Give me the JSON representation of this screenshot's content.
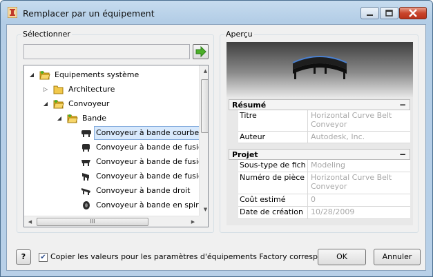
{
  "window": {
    "title": "Remplacer par un équipement"
  },
  "select_group": {
    "label": "Sélectionner"
  },
  "search": {
    "value": ""
  },
  "tree": [
    {
      "label": "Equipements système",
      "icon": "folder-open-icon",
      "expander": "expanded"
    },
    {
      "label": "Architecture",
      "icon": "folder-icon",
      "expander": "collapsed"
    },
    {
      "label": "Convoyeur",
      "icon": "folder-open-icon",
      "expander": "expanded"
    },
    {
      "label": "Bande",
      "icon": "folder-open-icon",
      "expander": "expanded"
    },
    {
      "label": "Convoyeur à bande courbe hor",
      "icon": "conveyor-icon",
      "selected": true
    },
    {
      "label": "Convoyeur à bande de fusion X",
      "icon": "conveyor-icon"
    },
    {
      "label": "Convoyeur à bande de fusion Y",
      "icon": "conveyor-icon"
    },
    {
      "label": "Convoyeur à bande de fusion Y",
      "icon": "conveyor-icon"
    },
    {
      "label": "Convoyeur à bande droit",
      "icon": "conveyor-icon"
    },
    {
      "label": "Convoyeur à bande en spirale (",
      "icon": "conveyor-icon"
    }
  ],
  "tree_scrollbar": {
    "hthumb_grip": "III"
  },
  "preview_group": {
    "label": "Aperçu"
  },
  "summary": {
    "title": "Résumé",
    "toggle": "−",
    "rows": [
      {
        "key": "Titre",
        "value": "Horizontal Curve Belt Conveyor"
      },
      {
        "key": "Auteur",
        "value": "Autodesk, Inc."
      }
    ]
  },
  "project": {
    "title": "Projet",
    "toggle": "−",
    "rows": [
      {
        "key": "Sous-type de fichie",
        "value": "Modeling"
      },
      {
        "key": "Numéro de pièce",
        "value": "Horizontal Curve Belt Conveyor"
      },
      {
        "key": "Coût estimé",
        "value": "0"
      },
      {
        "key": "Date de création",
        "value": "10/28/2009"
      }
    ]
  },
  "footer": {
    "help_label": "?",
    "checkbox_checked": true,
    "checkbox_mark": "✔",
    "checkbox_label": "Copier les valeurs pour les paramètres d'équipements Factory correspondants",
    "ok_label": "OK",
    "cancel_label": "Annuler"
  }
}
